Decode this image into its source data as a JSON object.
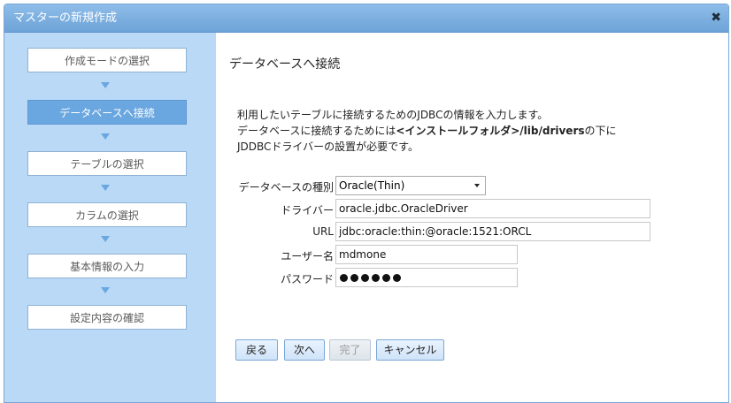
{
  "window": {
    "title": "マスターの新規作成",
    "close_icon": "close-icon"
  },
  "sidebar": {
    "steps": [
      {
        "label": "作成モードの選択",
        "active": false
      },
      {
        "label": "データベースへ接続",
        "active": true
      },
      {
        "label": "テーブルの選択",
        "active": false
      },
      {
        "label": "カラムの選択",
        "active": false
      },
      {
        "label": "基本情報の入力",
        "active": false
      },
      {
        "label": "設定内容の確認",
        "active": false
      }
    ]
  },
  "main": {
    "heading": "データベースへ接続",
    "desc_line1": "利用したいテーブルに接続するためのJDBCの情報を入力します。",
    "desc_line2_prefix": "データベースに接続するためには",
    "desc_line2_bold": "<インストールフォルダ>/lib/drivers",
    "desc_line2_suffix": "の下に",
    "desc_line3": "JDDBCドライバーの設置が必要です。"
  },
  "form": {
    "db_type_label": "データベースの種別",
    "db_type_value": "Oracle(Thin)",
    "driver_label": "ドライバー",
    "driver_value": "oracle.jdbc.OracleDriver",
    "url_label": "URL",
    "url_value": "jdbc:oracle:thin:@oracle:1521:ORCL",
    "user_label": "ユーザー名",
    "user_value": "mdmone",
    "password_label": "パスワード",
    "password_mask_count": 6
  },
  "buttons": {
    "back": "戻る",
    "next": "次へ",
    "finish": "完了",
    "cancel": "キャンセル"
  }
}
